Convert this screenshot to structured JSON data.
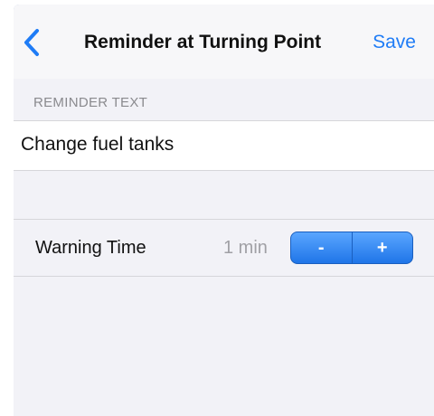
{
  "navbar": {
    "back_icon": "chevron-left-icon",
    "title": "Reminder at Turning Point",
    "save_label": "Save"
  },
  "reminder": {
    "section_header": "REMINDER TEXT",
    "text_value": "Change fuel tanks"
  },
  "warning": {
    "label": "Warning Time",
    "value": "1 min",
    "decrement_label": "-",
    "increment_label": "+"
  },
  "colors": {
    "accent": "#1f7cf6",
    "background": "#f2f2f7",
    "stepper": "#2f86f0"
  }
}
